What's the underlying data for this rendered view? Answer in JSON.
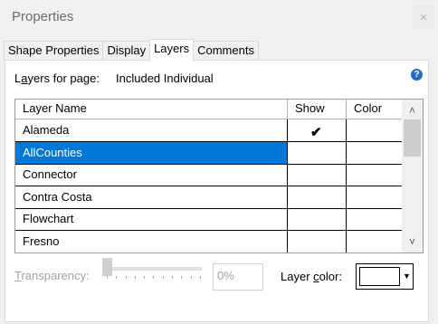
{
  "window": {
    "title": "Properties",
    "close_icon": "close-icon"
  },
  "tabs": [
    {
      "label": "Shape Properties",
      "active": false
    },
    {
      "label": "Display",
      "active": false
    },
    {
      "label": "Layers",
      "active": true
    },
    {
      "label": "Comments",
      "active": false
    }
  ],
  "layers_for_page": {
    "label_pre": "L",
    "label_mnemonic": "a",
    "label_post": "yers for page:",
    "value": "Included Individual"
  },
  "help_icon": "?",
  "grid": {
    "columns": [
      "Layer Name",
      "Show",
      "Color"
    ],
    "rows": [
      {
        "name": "Alameda",
        "show": "✔",
        "selected": false
      },
      {
        "name": "AllCounties",
        "show": "",
        "selected": true
      },
      {
        "name": "Connector",
        "show": "",
        "selected": false
      },
      {
        "name": "Contra Costa",
        "show": "",
        "selected": false
      },
      {
        "name": "Flowchart",
        "show": "",
        "selected": false
      },
      {
        "name": "Fresno",
        "show": "",
        "selected": false
      }
    ],
    "scroll_up_icon": "˄",
    "scroll_down_icon": "˅"
  },
  "transparency": {
    "label_mnemonic": "T",
    "label_rest": "ransparency:",
    "value": "0%",
    "level": 0
  },
  "layer_color": {
    "label_pre": "Layer ",
    "label_mnemonic": "c",
    "label_post": "olor:",
    "value": "#ffffff",
    "arrow_icon": "▼"
  }
}
